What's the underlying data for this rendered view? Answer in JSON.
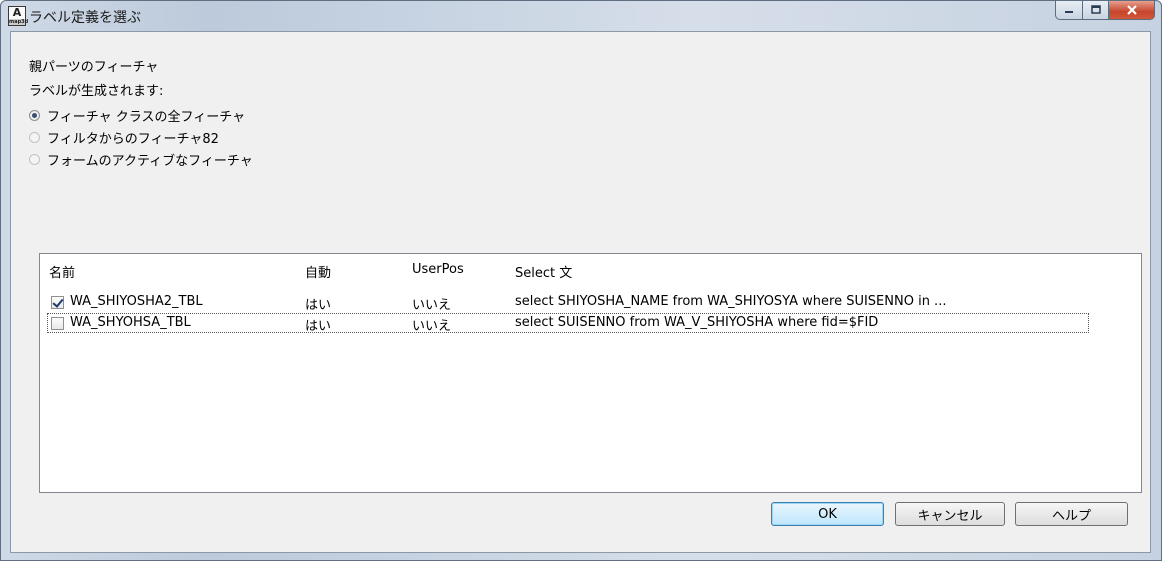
{
  "window": {
    "title": "ラベル定義を選ぶ",
    "icon_text": "A",
    "icon_sub": "map3d"
  },
  "parent_feature_label": "親パーツのフィーチャ",
  "label_generated_label": "ラベルが生成されます:",
  "radio_options": [
    {
      "label": "フィーチャ クラスの全フィーチャ",
      "checked": true
    },
    {
      "label": "フィルタからのフィーチャ82",
      "checked": false
    },
    {
      "label": "フォームのアクティブなフィーチャ",
      "checked": false
    }
  ],
  "table": {
    "headers": [
      "名前",
      "自動",
      "UserPos",
      "Select 文"
    ],
    "rows": [
      {
        "checked": true,
        "name": "WA_SHIYOSHA2_TBL",
        "auto": "はい",
        "userpos": "いいえ",
        "select": "select SHIYOSHA_NAME from WA_SHIYOSYA   where SUISENNO in ..."
      },
      {
        "checked": false,
        "name": "WA_SHYOHSA_TBL",
        "auto": "はい",
        "userpos": "いいえ",
        "select": "select SUISENNO from WA_V_SHIYOSHA where fid=$FID"
      }
    ]
  },
  "buttons": {
    "ok": "OK",
    "cancel": "キャンセル",
    "help": "ヘルプ"
  }
}
